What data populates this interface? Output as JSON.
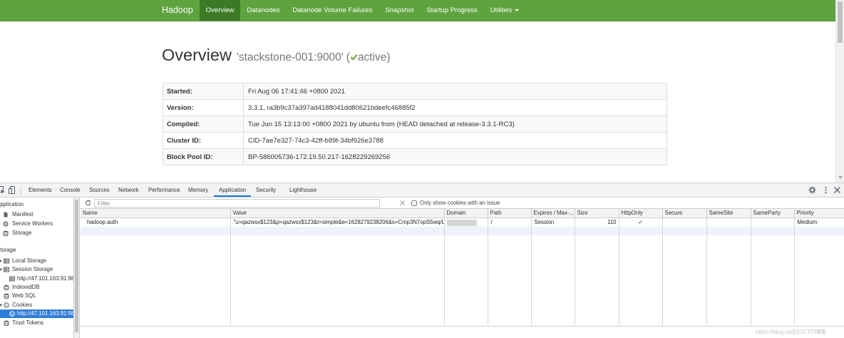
{
  "navbar": {
    "brand": "Hadoop",
    "items": [
      "Overview",
      "Datanodes",
      "Datanode Volume Failures",
      "Snapshot",
      "Startup Progress",
      "Utilities"
    ],
    "active_item": "Overview"
  },
  "overview": {
    "title": "Overview",
    "address": "'stackstone-001:9000'",
    "status_open": "(",
    "status": "active",
    "status_close": ")",
    "info_rows": [
      {
        "label": "Started:",
        "value": "Fri Aug 06 17:41:46 +0800 2021"
      },
      {
        "label": "Version:",
        "value": "3.3.1, ra3b9c37a397ad4188041dd80621bdeefc46885f2"
      },
      {
        "label": "Compiled:",
        "value": "Tue Jun 15 13:13:00 +0800 2021 by ubuntu from (HEAD detached at release-3.3.1-RC3)"
      },
      {
        "label": "Cluster ID:",
        "value": "CID-7ae7e327-74c3-42ff-b89f-34bf926e3788"
      },
      {
        "label": "Block Pool ID:",
        "value": "BP-586005736-172.19.50.217-1628229269256"
      }
    ]
  },
  "devtools": {
    "tabs": [
      "Elements",
      "Console",
      "Sources",
      "Network",
      "Performance",
      "Memory",
      "Application",
      "Security",
      "Lighthouse"
    ],
    "active_tab": "Application",
    "sidebar": {
      "items": [
        {
          "label": "Application",
          "kind": "section"
        },
        {
          "label": "Manifest",
          "icon": "document-icon"
        },
        {
          "label": "Service Workers",
          "icon": "gear-icon"
        },
        {
          "label": "Storage",
          "icon": "database-icon"
        },
        {
          "label": "Storage",
          "kind": "section"
        },
        {
          "label": "Local Storage",
          "icon": "grid-icon",
          "expanded": false
        },
        {
          "label": "Session Storage",
          "icon": "grid-icon",
          "expanded": true
        },
        {
          "label": "http://47.101.163.91:98",
          "icon": "grid-icon",
          "child": true
        },
        {
          "label": "IndexedDB",
          "icon": "database-icon"
        },
        {
          "label": "Web SQL",
          "icon": "database-icon"
        },
        {
          "label": "Cookies",
          "icon": "cookie-icon",
          "expanded": true
        },
        {
          "label": "http://47.101.163.91:98",
          "icon": "cookie-icon",
          "child": true,
          "selected": true
        },
        {
          "label": "Trust Tokens",
          "icon": "database-icon"
        }
      ]
    },
    "cookies": {
      "filter_placeholder": "Filter",
      "issue_filter_label": "Only show cookies with an issue",
      "issue_filter_checked": false,
      "columns": [
        "Name",
        "Value",
        "Domain",
        "Path",
        "Expires / Max-...",
        "Size",
        "HttpOnly",
        "Secure",
        "SameSite",
        "SameParty",
        "Priority"
      ],
      "rows": [
        {
          "name": "hadoop.auth",
          "value": "\"u=qazwsx$123&p=qazwsx$123&t=simple&e=1628279238206&s=Cmp3N7opS5wq/L...",
          "path": "/",
          "expires": "Session",
          "size": "110",
          "httponly": "✓",
          "secure": "",
          "samesite": "",
          "sameparty": "",
          "priority": "Medium"
        }
      ]
    }
  },
  "watermark": "https://blog.cs@51CTO博客",
  "colors": {
    "navbar_bg": "#5fa33e",
    "navbar_active": "#3c7a25",
    "status_check": "#5fa33e",
    "devtools_accent": "#1a73e8",
    "sidebar_selected": "#2e7dd9"
  }
}
